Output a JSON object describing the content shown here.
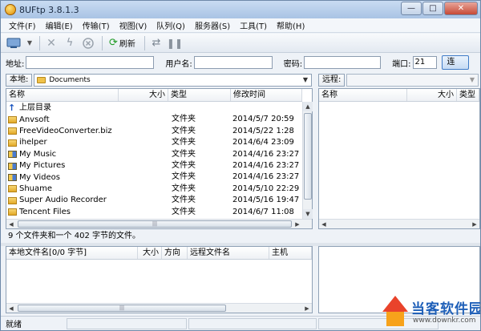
{
  "window": {
    "title": "8UFtp 3.8.1.3",
    "buttons": [
      "—",
      "□",
      "✕"
    ]
  },
  "menu": [
    "文件(F)",
    "编辑(E)",
    "传输(T)",
    "视图(V)",
    "队列(Q)",
    "服务器(S)",
    "工具(T)",
    "帮助(H)"
  ],
  "toolbar": {
    "refresh_label": "刷新"
  },
  "address": {
    "host_label": "地址:",
    "host_value": "",
    "user_label": "用户名:",
    "user_value": "",
    "password_label": "密码:",
    "password_value": "",
    "port_label": "端口:",
    "port_value": "21",
    "connect_label": "连"
  },
  "local": {
    "label": "本地:",
    "path": "Documents",
    "columns": [
      "名称",
      "大小",
      "类型",
      "修改时间"
    ],
    "rows": [
      {
        "name": "上层目录",
        "type": "",
        "modified": "",
        "icon": "up-arrow-icon"
      },
      {
        "name": "Anvsoft",
        "type": "文件夹",
        "modified": "2014/5/7 20:59",
        "icon": "folder-icon"
      },
      {
        "name": "FreeVideoConverter.biz",
        "type": "文件夹",
        "modified": "2014/5/22 1:28",
        "icon": "folder-icon"
      },
      {
        "name": "ihelper",
        "type": "文件夹",
        "modified": "2014/6/4 23:09",
        "icon": "folder-icon"
      },
      {
        "name": "My Music",
        "type": "文件夹",
        "modified": "2014/4/16 23:27",
        "icon": "music-folder-icon"
      },
      {
        "name": "My Pictures",
        "type": "文件夹",
        "modified": "2014/4/16 23:27",
        "icon": "pictures-folder-icon"
      },
      {
        "name": "My Videos",
        "type": "文件夹",
        "modified": "2014/4/16 23:27",
        "icon": "videos-folder-icon"
      },
      {
        "name": "Shuame",
        "type": "文件夹",
        "modified": "2014/5/10 22:29",
        "icon": "folder-icon"
      },
      {
        "name": "Super Audio Recorder",
        "type": "文件夹",
        "modified": "2014/5/16 19:47",
        "icon": "folder-icon"
      },
      {
        "name": "Tencent Files",
        "type": "文件夹",
        "modified": "2014/6/7 11:08",
        "icon": "folder-icon"
      }
    ],
    "status": "9 个文件夹和一个 402 字节的文件。"
  },
  "remote": {
    "label": "远程:",
    "columns": [
      "名称",
      "大小",
      "类型"
    ]
  },
  "queue": {
    "columns": [
      "本地文件名[0/0 字节]",
      "大小",
      "方向",
      "远程文件名",
      "主机"
    ]
  },
  "statusbar": {
    "text": "就绪"
  },
  "watermark": {
    "title": "当客软件园",
    "url": "www.downkr.com"
  }
}
